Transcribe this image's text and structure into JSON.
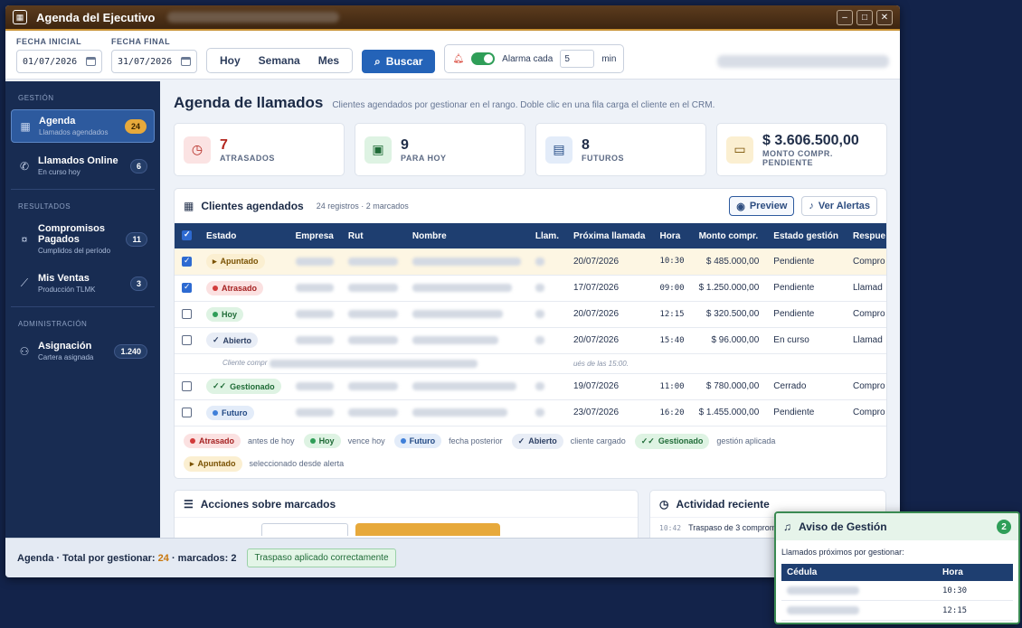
{
  "window": {
    "title": "Agenda del Ejecutivo"
  },
  "toolbar": {
    "fecha_inicial_label": "FECHA INICIAL",
    "fecha_inicial_value": "01/07/2026",
    "fecha_final_label": "FECHA FINAL",
    "fecha_final_value": "31/07/2026",
    "range_buttons": [
      "Hoy",
      "Semana",
      "Mes"
    ],
    "search_label": "Buscar",
    "alarm_label": "Alarma cada",
    "alarm_value": "5",
    "alarm_unit": "min"
  },
  "sidebar": {
    "section_gestion": "GESTIÓN",
    "section_resultados": "RESULTADOS",
    "section_admin": "ADMINISTRACIÓN",
    "items": [
      {
        "label": "Agenda",
        "sub": "Llamados agendados",
        "badge": "24",
        "icon": "calendar-icon"
      },
      {
        "label": "Llamados Online",
        "sub": "En curso hoy",
        "badge": "6",
        "icon": "phone-icon"
      },
      {
        "label": "Compromisos Pagados",
        "sub": "Cumplidos del período",
        "badge": "11",
        "icon": "money-icon"
      },
      {
        "label": "Mis Ventas",
        "sub": "Producción TLMK",
        "badge": "3",
        "icon": "chart-icon"
      },
      {
        "label": "Asignación",
        "sub": "Cartera asignada",
        "badge": "1.240",
        "icon": "users-icon"
      }
    ]
  },
  "main": {
    "title": "Agenda de llamados",
    "subtitle": "Clientes agendados por gestionar en el rango. Doble clic en una fila carga el cliente en el CRM."
  },
  "kpis": [
    {
      "value": "7",
      "label": "ATRASADOS",
      "color": "#b3261e",
      "bg": "#fbe3e3",
      "icon": "clock-icon"
    },
    {
      "value": "9",
      "label": "PARA HOY",
      "color": "#1b2a46",
      "bg": "#def3e3",
      "icon": "calendar-check-icon"
    },
    {
      "value": "8",
      "label": "FUTUROS",
      "color": "#1b2a46",
      "bg": "#e3ecf9",
      "icon": "calendar-forward-icon"
    },
    {
      "value": "$ 3.606.500,00",
      "label": "MONTO COMPR. PENDIENTE",
      "color": "#1b2a46",
      "bg": "#fbefd1",
      "icon": "cash-icon"
    }
  ],
  "panel": {
    "title": "Clientes agendados",
    "count": "24 registros · 2 marcados",
    "preview_label": "Preview",
    "alerts_label": "Ver Alertas",
    "columns": [
      "Estado",
      "Empresa",
      "Rut",
      "Nombre",
      "Llam.",
      "Próxima llamada",
      "Hora",
      "Monto compr.",
      "Estado gestión",
      "Respue"
    ],
    "rows": [
      {
        "checked": true,
        "estado": "Apuntado",
        "fecha": "20/07/2026",
        "hora": "10:30",
        "monto": "$ 485.000,00",
        "gestion": "Pendiente",
        "respuesta": "Compro"
      },
      {
        "checked": true,
        "estado": "Atrasado",
        "fecha": "17/07/2026",
        "hora": "09:00",
        "monto": "$ 1.250.000,00",
        "gestion": "Pendiente",
        "respuesta": "Llamad"
      },
      {
        "checked": false,
        "estado": "Hoy",
        "fecha": "20/07/2026",
        "hora": "12:15",
        "monto": "$ 320.500,00",
        "gestion": "Pendiente",
        "respuesta": "Compro"
      },
      {
        "checked": false,
        "estado": "Abierto",
        "fecha": "20/07/2026",
        "hora": "15:40",
        "monto": "$ 96.000,00",
        "gestion": "En curso",
        "respuesta": "Llamad"
      },
      {
        "checked": false,
        "estado": "Gestionado",
        "fecha": "19/07/2026",
        "hora": "11:00",
        "monto": "$ 780.000,00",
        "gestion": "Cerrado",
        "respuesta": "Compro"
      },
      {
        "checked": false,
        "estado": "Futuro",
        "fecha": "23/07/2026",
        "hora": "16:20",
        "monto": "$ 1.455.000,00",
        "gestion": "Pendiente",
        "respuesta": "Compro"
      }
    ],
    "note_left": "Cliente compr",
    "note_right": "ués de las 15:00."
  },
  "legend": [
    {
      "pill": "Atrasado",
      "desc": "antes de hoy"
    },
    {
      "pill": "Hoy",
      "desc": "vence hoy"
    },
    {
      "pill": "Futuro",
      "desc": "fecha posterior"
    },
    {
      "pill": "Abierto",
      "desc": "cliente cargado"
    },
    {
      "pill": "Gestionado",
      "desc": "gestión aplicada"
    },
    {
      "pill": "Apuntado",
      "desc": "seleccionado desde alerta"
    }
  ],
  "acciones": {
    "title": "Acciones sobre marcados"
  },
  "actividad": {
    "title": "Actividad reciente",
    "time": "10:42",
    "text": "Traspaso de 3 comprom"
  },
  "status": {
    "prefix": "Agenda · Total por gestionar:",
    "total": "24",
    "mid": "· marcados: 2",
    "chip": "Traspaso aplicado correctamente"
  },
  "toast": {
    "title": "Aviso de Gestión",
    "badge": "2",
    "message": "Llamados próximos por gestionar:",
    "col_cedula": "Cédula",
    "col_hora": "Hora",
    "rows": [
      {
        "hora": "10:30"
      },
      {
        "hora": "12:15"
      }
    ]
  }
}
